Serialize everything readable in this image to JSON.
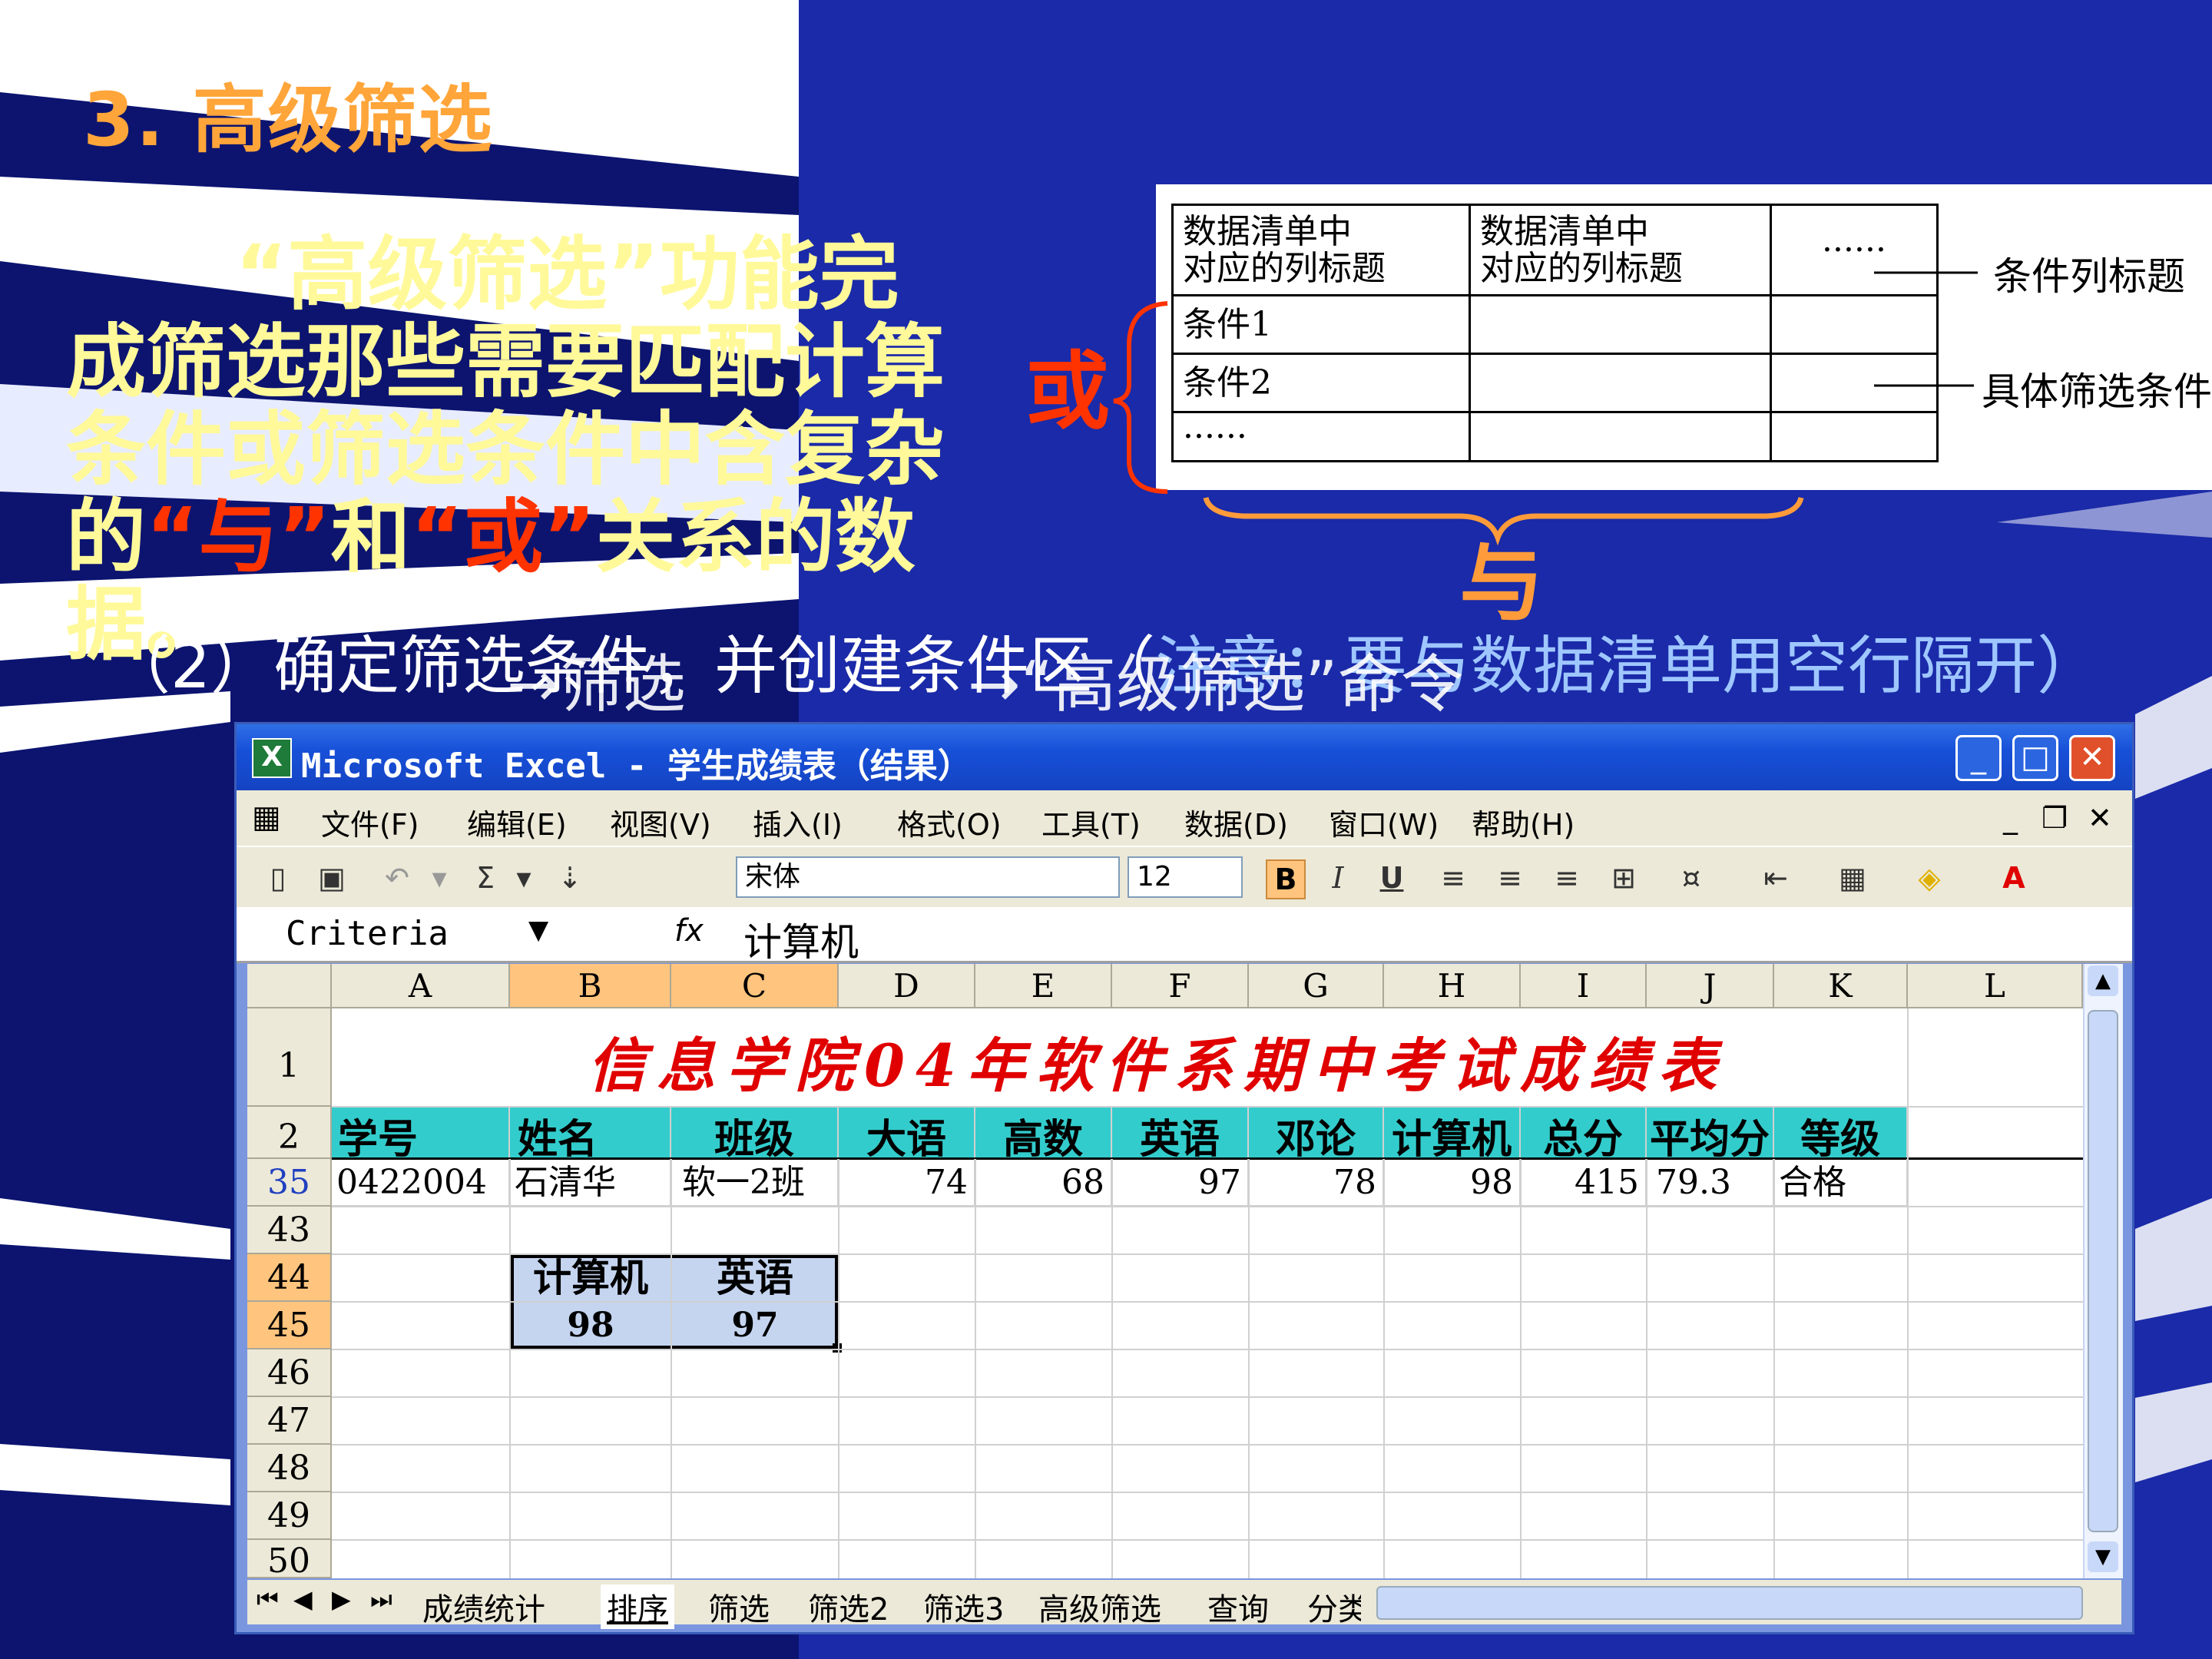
{
  "slide": {
    "title": "3. 高级筛选",
    "para": {
      "p1": "“高级筛选”功能完成筛选那些需要匹配计算条件或筛选条件中含复杂的",
      "p2": "“与”",
      "p3": "和",
      "p4": "“或”",
      "p5": "关系的数据。"
    },
    "step": {
      "prefix": "（2）确定筛选条件，并创建条件区（",
      "note": "注意：要与数据清单用空行隔开）"
    },
    "overlay": {
      "a": "→筛选",
      "b": "→“高级筛选”命令"
    }
  },
  "criteria_diagram": {
    "header1": [
      "数据清单中",
      "对应的列标题"
    ],
    "header2": [
      "数据清单中",
      "对应的列标题"
    ],
    "header3": "······",
    "rows": [
      "条件1",
      "条件2",
      "······"
    ],
    "label_header": "条件列标题",
    "label_conditions": "具体筛选条件",
    "or": "或",
    "and": "与"
  },
  "excel": {
    "title": "Microsoft Excel - 学生成绩表（结果）",
    "menu": [
      "文件(F)",
      "编辑(E)",
      "视图(V)",
      "插入(I)",
      "格式(O)",
      "工具(T)",
      "数据(D)",
      "窗口(W)",
      "帮助(H)"
    ],
    "font_name": "宋体",
    "font_size": "12",
    "name_box": "Criteria",
    "formula": "计算机",
    "columns": [
      "A",
      "B",
      "C",
      "D",
      "E",
      "F",
      "G",
      "H",
      "I",
      "J",
      "K",
      "L"
    ],
    "sheet_title": "信息学院04年软件系期中考试成绩表",
    "headers": [
      "学号",
      "姓名",
      "班级",
      "大语",
      "高数",
      "英语",
      "邓论",
      "计算机",
      "总分",
      "平均分",
      "等级"
    ],
    "record": [
      "0422004",
      "石清华",
      "软一2班",
      "74",
      "68",
      "97",
      "78",
      "98",
      "415",
      "79.3",
      "合格"
    ],
    "rows": [
      "1",
      "2",
      "35",
      "43",
      "44",
      "45",
      "46",
      "47",
      "48",
      "49",
      "50"
    ],
    "criteria": {
      "h1": "计算机",
      "h2": "英语",
      "v1": "98",
      "v2": "97"
    },
    "tabs": [
      "成绩统计",
      "排序",
      "筛选",
      "筛选2",
      "筛选3",
      "高级筛选",
      "查询",
      "分类"
    ],
    "colors": {
      "title_bar": "#1750d8",
      "header_fill": "#33cccc",
      "criteria_fill": "#c5d5f0",
      "selection": "#ffc47d"
    }
  }
}
